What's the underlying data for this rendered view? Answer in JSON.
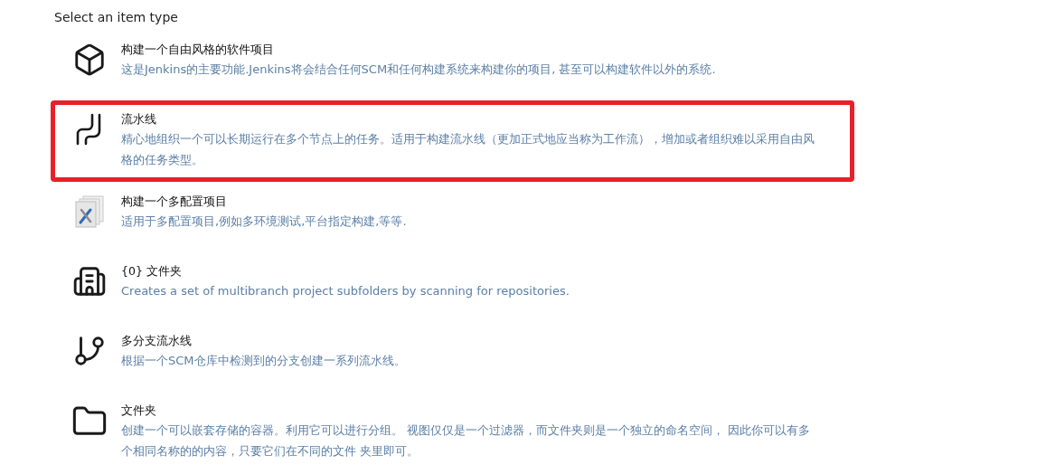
{
  "heading": "Select an item type",
  "items": [
    {
      "kind": "freestyle",
      "title": "构建一个自由风格的软件项目",
      "description": "这是Jenkins的主要功能.Jenkins将会结合任何SCM和任何构建系统来构建你的项目, 甚至可以构建软件以外的系统.",
      "highlighted": false
    },
    {
      "kind": "pipeline",
      "title": "流水线",
      "description": "精心地组织一个可以长期运行在多个节点上的任务。适用于构建流水线（更加正式地应当称为工作流），增加或者组织难以采用自由风格的任务类型。",
      "highlighted": true
    },
    {
      "kind": "matrix",
      "title": "构建一个多配置项目",
      "description": "适用于多配置项目,例如多环境测试,平台指定构建,等等.",
      "highlighted": false
    },
    {
      "kind": "organization",
      "title": "{0} 文件夹",
      "description": "Creates a set of multibranch project subfolders by scanning for repositories.",
      "highlighted": false
    },
    {
      "kind": "multibranch",
      "title": "多分支流水线",
      "description": "根据一个SCM仓库中检测到的分支创建一系列流水线。",
      "highlighted": false
    },
    {
      "kind": "folder",
      "title": "文件夹",
      "description": "创建一个可以嵌套存储的容器。利用它可以进行分组。 视图仅仅是一个过滤器，而文件夹则是一个独立的命名空间， 因此你可以有多个相同名称的的内容，只要它们在不同的文件 夹里即可。",
      "highlighted": false
    }
  ]
}
